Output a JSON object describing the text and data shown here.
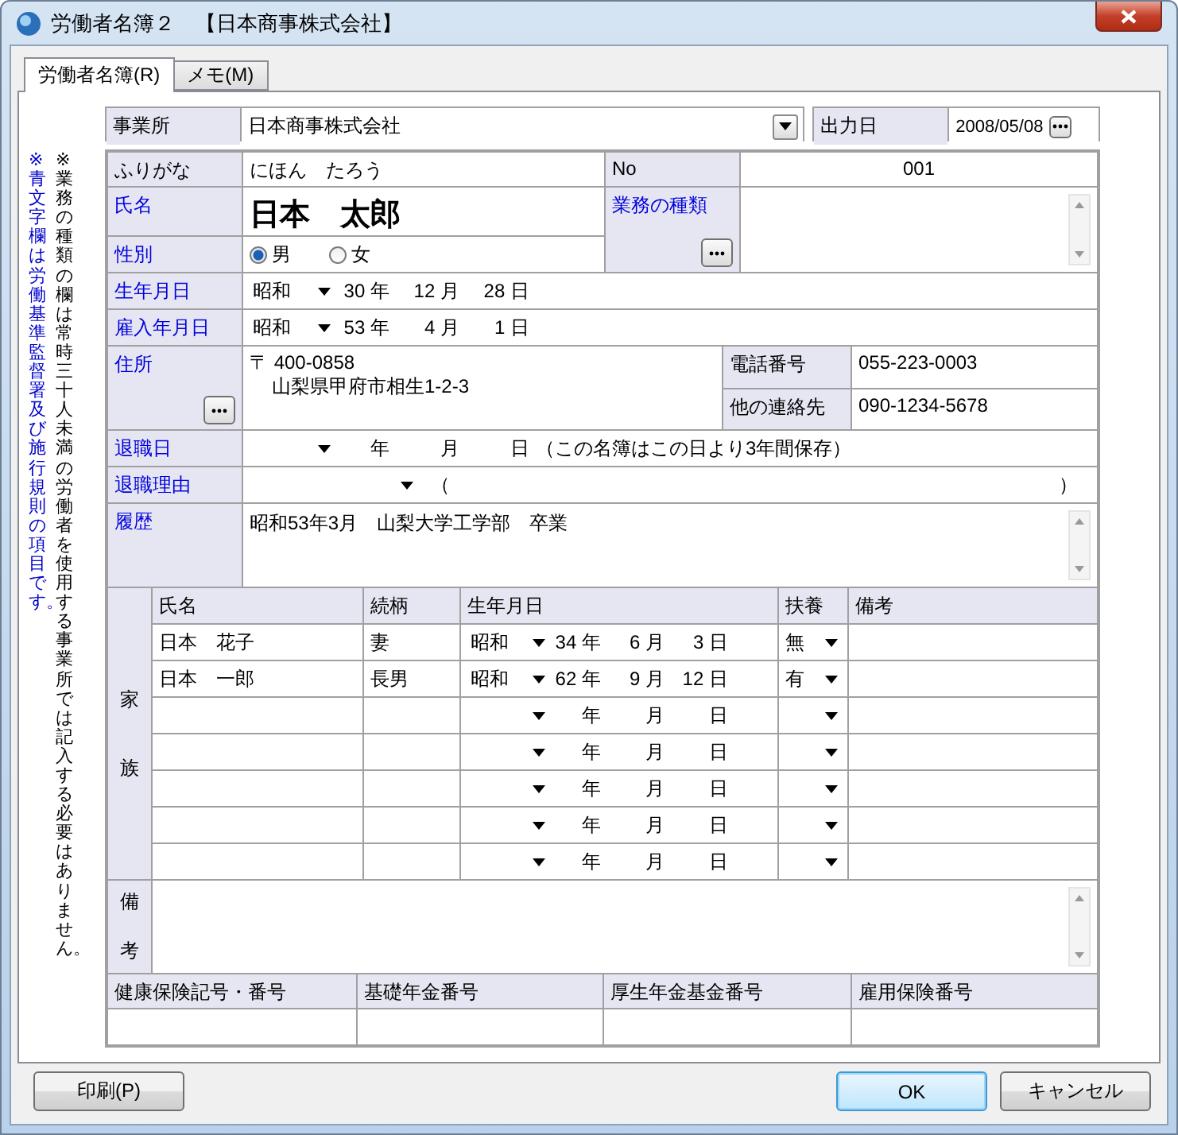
{
  "window": {
    "title": "労働者名簿２　【日本商事株式会社】"
  },
  "tabs": [
    {
      "label": "労働者名簿(R)",
      "selected": true
    },
    {
      "label": "メモ(M)",
      "selected": false
    }
  ],
  "notes": [
    {
      "text": "※青文字欄は労働基準監督署及び施行規則の項目です。",
      "color": "#0000cc"
    },
    {
      "text": "※業務の種類の欄は常時三十人未満の労働者を使用する事業所では記入する必要はありません。",
      "color": "#000000"
    }
  ],
  "office": {
    "label": {
      "text": "事業所",
      "statutory": false
    },
    "value": "日本商事株式会社"
  },
  "output_date": {
    "label": {
      "text": "出力日",
      "statutory": false
    },
    "value": "2008/05/08"
  },
  "furigana": {
    "label": {
      "text": "ふりがな",
      "statutory": false
    },
    "value": "にほん　たろう"
  },
  "number": {
    "label": {
      "text": "No",
      "statutory": false
    },
    "value": "001"
  },
  "name": {
    "label": {
      "text": "氏名",
      "statutory": true
    },
    "value": "日本　太郎"
  },
  "job_type": {
    "label": {
      "text": "業務の種類",
      "statutory": true
    }
  },
  "gender": {
    "label": {
      "text": "性別",
      "statutory": true
    },
    "options": [
      {
        "label": "男",
        "selected": true
      },
      {
        "label": "女",
        "selected": false
      }
    ]
  },
  "birth_date": {
    "label": {
      "text": "生年月日",
      "statutory": true
    },
    "date": {
      "era": "昭和",
      "parts": [
        {
          "value": "30",
          "unit": "年"
        },
        {
          "value": "12",
          "unit": "月"
        },
        {
          "value": "28",
          "unit": "日"
        }
      ]
    }
  },
  "hire_date": {
    "label": {
      "text": "雇入年月日",
      "statutory": true
    },
    "date": {
      "era": "昭和",
      "parts": [
        {
          "value": "53",
          "unit": "年"
        },
        {
          "value": "4",
          "unit": "月"
        },
        {
          "value": "1",
          "unit": "日"
        }
      ]
    }
  },
  "address": {
    "label": {
      "text": "住所",
      "statutory": true
    },
    "postal": "〒 400-0858",
    "line": "山梨県甲府市相生1-2-3"
  },
  "phone": {
    "label": {
      "text": "電話番号",
      "statutory": false
    },
    "value": "055-223-0003"
  },
  "other_contact": {
    "label": {
      "text": "他の連絡先",
      "statutory": false
    },
    "value": "090-1234-5678"
  },
  "retirement_date": {
    "label": {
      "text": "退職日",
      "statutory": true
    },
    "date": {
      "parts": [
        {
          "unit": "年"
        },
        {
          "unit": "月"
        },
        {
          "unit": "日"
        }
      ]
    },
    "note": "（この名簿はこの日より3年間保存）"
  },
  "retirement_reason": {
    "label": {
      "text": "退職理由",
      "statutory": true
    },
    "open": "（",
    "close": "）"
  },
  "history": {
    "label": {
      "text": "履歴",
      "statutory": true
    },
    "value": "昭和53年3月　山梨大学工学部　卒業"
  },
  "family": {
    "label": [
      "家",
      "族"
    ],
    "columns": [
      "氏名",
      "続柄",
      "生年月日",
      "扶養",
      "備考"
    ],
    "rows": [
      {
        "name": "日本　花子",
        "relation": "妻",
        "birth": {
          "era": "昭和",
          "parts": [
            {
              "value": "34",
              "unit": "年"
            },
            {
              "value": "6",
              "unit": "月"
            },
            {
              "value": "3",
              "unit": "日"
            }
          ]
        },
        "dependent": "無"
      },
      {
        "name": "日本　一郎",
        "relation": "長男",
        "birth": {
          "era": "昭和",
          "parts": [
            {
              "value": "62",
              "unit": "年"
            },
            {
              "value": "9",
              "unit": "月"
            },
            {
              "value": "12",
              "unit": "日"
            }
          ]
        },
        "dependent": "有"
      },
      {
        "birth": {
          "parts": [
            {
              "unit": "年"
            },
            {
              "unit": "月"
            },
            {
              "unit": "日"
            }
          ]
        }
      },
      {
        "birth": {
          "parts": [
            {
              "unit": "年"
            },
            {
              "unit": "月"
            },
            {
              "unit": "日"
            }
          ]
        }
      },
      {
        "birth": {
          "parts": [
            {
              "unit": "年"
            },
            {
              "unit": "月"
            },
            {
              "unit": "日"
            }
          ]
        }
      },
      {
        "birth": {
          "parts": [
            {
              "unit": "年"
            },
            {
              "unit": "月"
            },
            {
              "unit": "日"
            }
          ]
        }
      },
      {
        "birth": {
          "parts": [
            {
              "unit": "年"
            },
            {
              "unit": "月"
            },
            {
              "unit": "日"
            }
          ]
        }
      }
    ]
  },
  "remarks": {
    "label": [
      "備",
      "考"
    ]
  },
  "insurance": {
    "columns": [
      "健康保険記号・番号",
      "基礎年金番号",
      "厚生年金基金番号",
      "雇用保険番号"
    ]
  },
  "buttons": [
    {
      "label": "印刷(P)",
      "kind": "left",
      "default": false
    },
    {
      "label": "OK",
      "kind": "right",
      "default": true
    },
    {
      "label": "キャンセル",
      "kind": "right",
      "default": false
    }
  ]
}
